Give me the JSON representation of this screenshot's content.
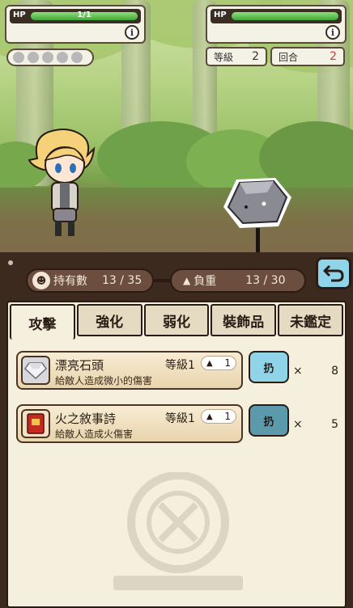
{
  "player_hud": {
    "hp_label": "HP",
    "hp_value": "1/1",
    "hp_fraction": 1.0,
    "info_glyph": "i"
  },
  "enemy_hud": {
    "hp_label": "HP",
    "hp_value": "",
    "hp_fraction": 1.0,
    "info_glyph": "i"
  },
  "skill_dots": {
    "count": 5
  },
  "level": {
    "label": "等級",
    "value": "2"
  },
  "round": {
    "label": "回合",
    "value": "2"
  },
  "colors": {
    "hp_green": "#3fa83a",
    "round_red": "#d43a3a",
    "toss_blue_active": "#8fd4e8",
    "toss_blue_dim": "#5a9aaa"
  },
  "inventory": {
    "held_label": "持有數",
    "held_value": "13 / 35",
    "weight_label": "負重",
    "weight_value": "13 / 30",
    "back_icon": "back-arrow-icon",
    "tabs": [
      {
        "label": "攻擊",
        "active": true
      },
      {
        "label": "強化",
        "active": false
      },
      {
        "label": "弱化",
        "active": false
      },
      {
        "label": "裝飾品",
        "active": false
      },
      {
        "label": "未鑑定",
        "active": false
      }
    ],
    "items": [
      {
        "name": "漂亮石頭",
        "level": "等級1",
        "weight": "1",
        "desc": "給敵人造成微小的傷害",
        "toss": "扔",
        "times": "×",
        "qty": "8",
        "icon": "gem-icon"
      },
      {
        "name": "火之敘事詩",
        "level": "等級1",
        "weight": "1",
        "desc": "給敵人造成火傷害",
        "toss": "扔",
        "times": "×",
        "qty": "5",
        "icon": "red-book-icon"
      }
    ]
  }
}
